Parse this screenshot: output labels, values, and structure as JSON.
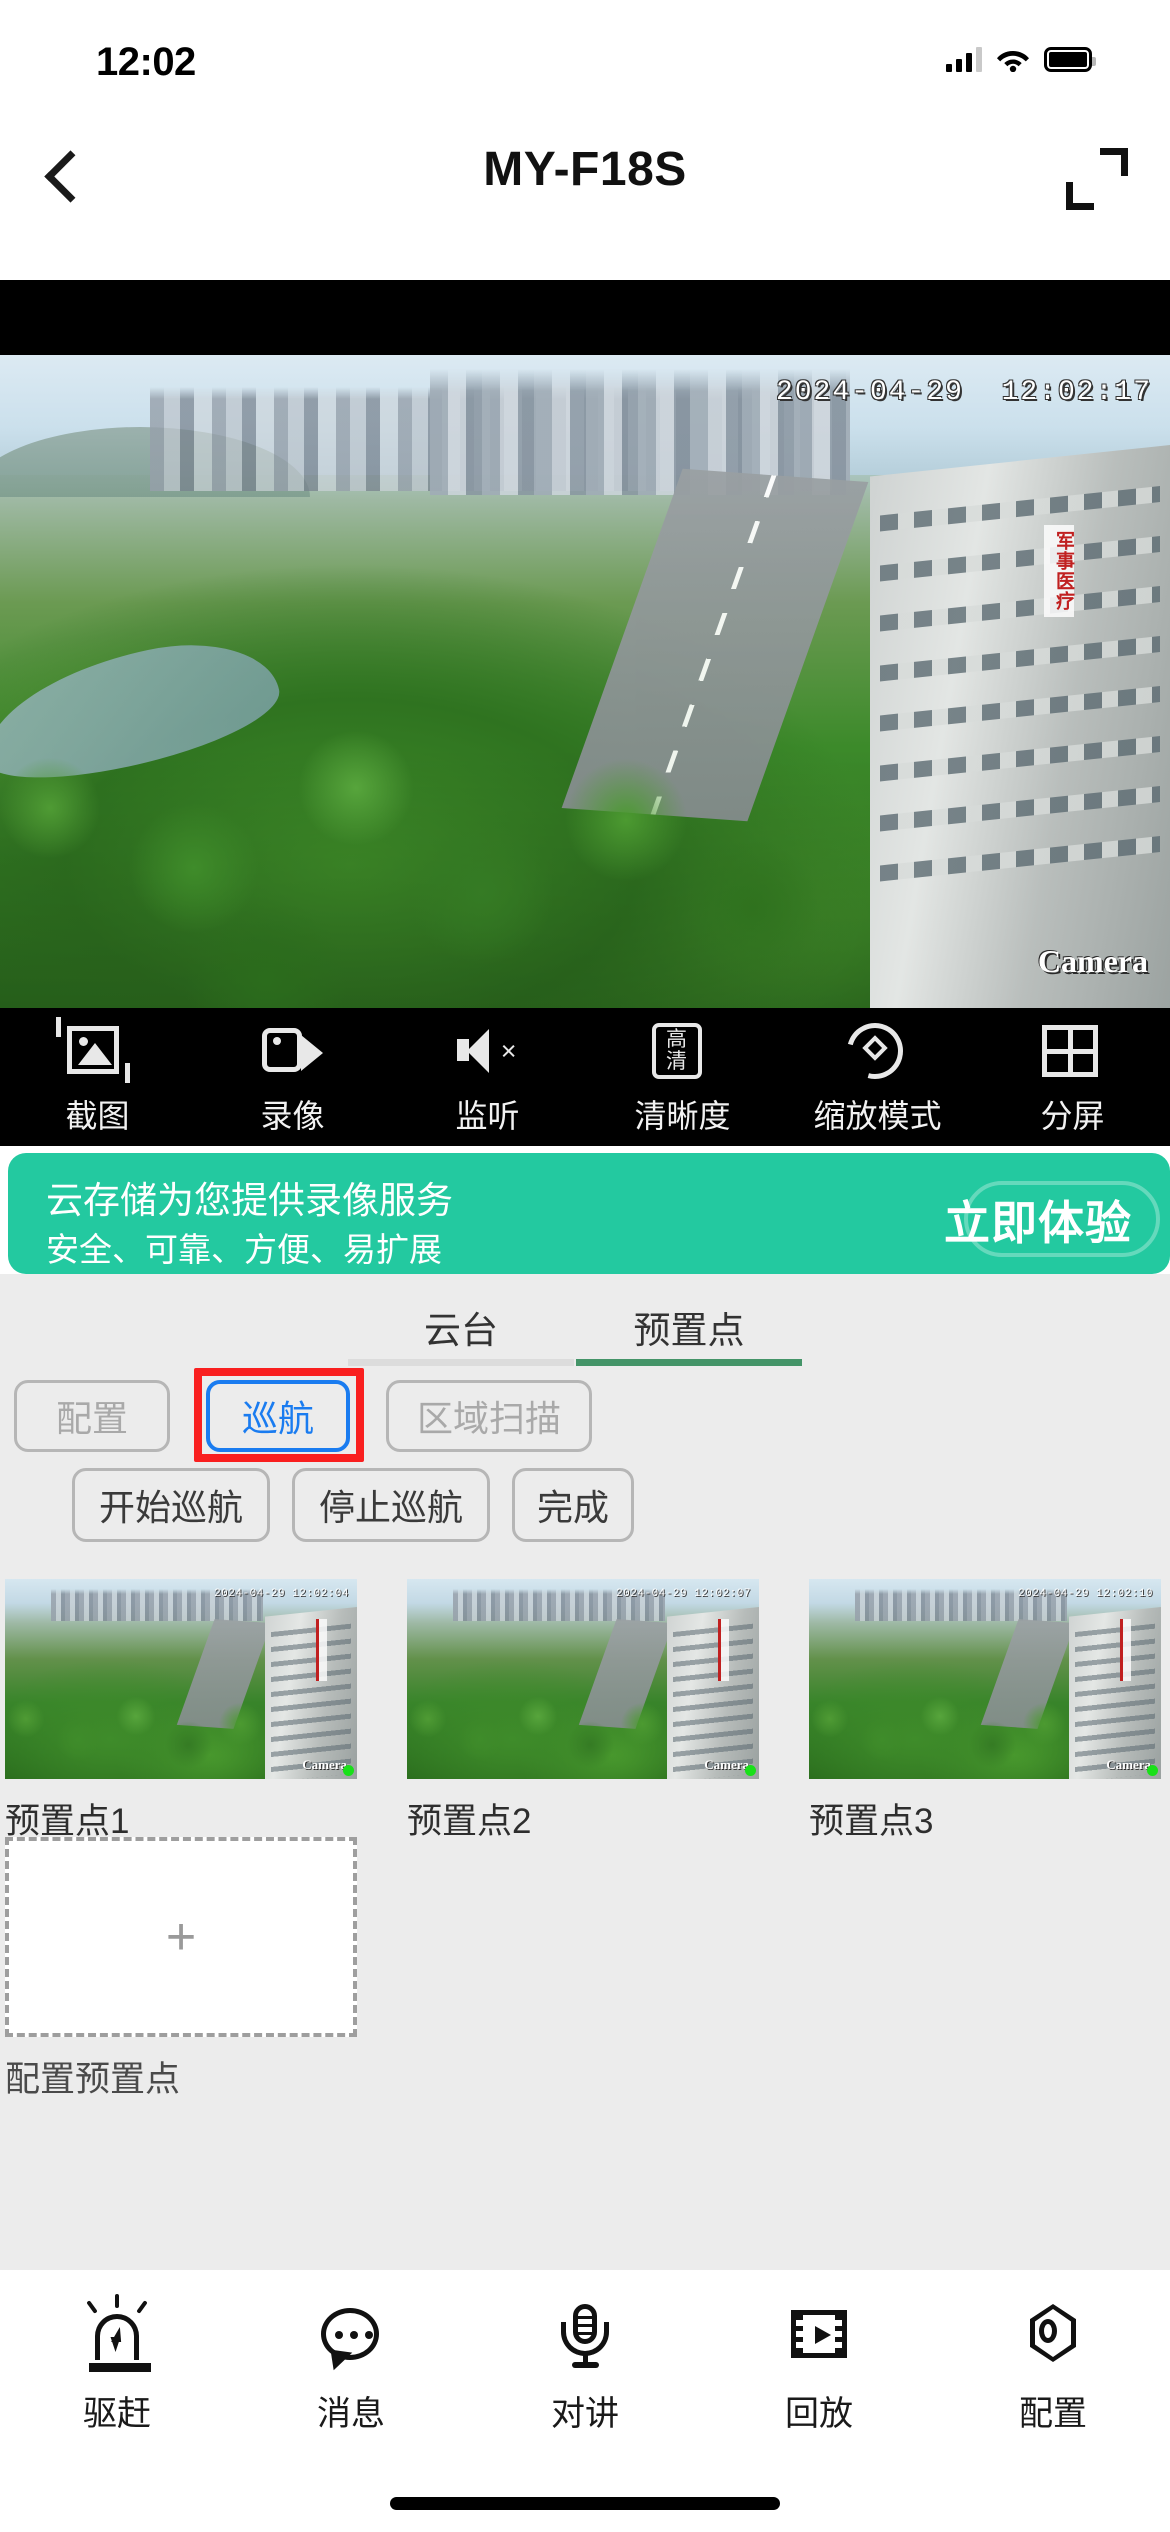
{
  "status_bar": {
    "time": "12:02",
    "signal_icon": "cellular-signal-icon",
    "wifi_icon": "wifi-icon",
    "battery_icon": "battery-icon"
  },
  "nav_bar": {
    "back_icon": "back-chevron-icon",
    "title": "MY-F18S",
    "fullscreen_icon": "fullscreen-expand-icon"
  },
  "video": {
    "timestamp": "2024-04-29  12:02:17",
    "watermark": "Camera"
  },
  "video_toolbar": [
    {
      "icon": "snapshot-icon",
      "label": "截图"
    },
    {
      "icon": "record-icon",
      "label": "录像"
    },
    {
      "icon": "listen-muted-icon",
      "label": "监听"
    },
    {
      "icon": "hd-quality-icon",
      "label": "清晰度",
      "badge": "高清"
    },
    {
      "icon": "zoom-mode-icon",
      "label": "缩放模式"
    },
    {
      "icon": "split-screen-icon",
      "label": "分屏"
    }
  ],
  "banner": {
    "line1": "云存储为您提供录像服务",
    "line2": "安全、可靠、方便、易扩展",
    "cta": "立即体验",
    "bg_color": "#23c9a0"
  },
  "tabs": [
    {
      "label": "云台",
      "active": false
    },
    {
      "label": "预置点",
      "active": true
    }
  ],
  "mode_buttons": [
    {
      "label": "配置",
      "state": "disabled"
    },
    {
      "label": "巡航",
      "state": "selected",
      "highlighted": true
    },
    {
      "label": "区域扫描",
      "state": "disabled"
    }
  ],
  "action_buttons": [
    {
      "label": "开始巡航"
    },
    {
      "label": "停止巡航"
    },
    {
      "label": "完成"
    }
  ],
  "presets": [
    {
      "label": "预置点1",
      "timestamp": "2024-04-29 12:02:04",
      "watermark": "Camera"
    },
    {
      "label": "预置点2",
      "timestamp": "2024-04-29 12:02:07",
      "watermark": "Camera"
    },
    {
      "label": "预置点3",
      "timestamp": "2024-04-29 12:02:10",
      "watermark": "Camera"
    }
  ],
  "add_preset": {
    "plus_icon": "plus-icon",
    "label": "配置预置点"
  },
  "bottom_nav": [
    {
      "icon": "siren-alarm-icon",
      "label": "驱赶"
    },
    {
      "icon": "message-bubble-icon",
      "label": "消息"
    },
    {
      "icon": "microphone-intercom-icon",
      "label": "对讲"
    },
    {
      "icon": "playback-film-icon",
      "label": "回放"
    },
    {
      "icon": "settings-hex-icon",
      "label": "配置"
    }
  ],
  "colors": {
    "accent_green": "#23c9a0",
    "tab_active": "#449468",
    "selected_blue": "#1a7cf0",
    "highlight_red": "#f91f1f",
    "panel_bg": "#ececec"
  }
}
